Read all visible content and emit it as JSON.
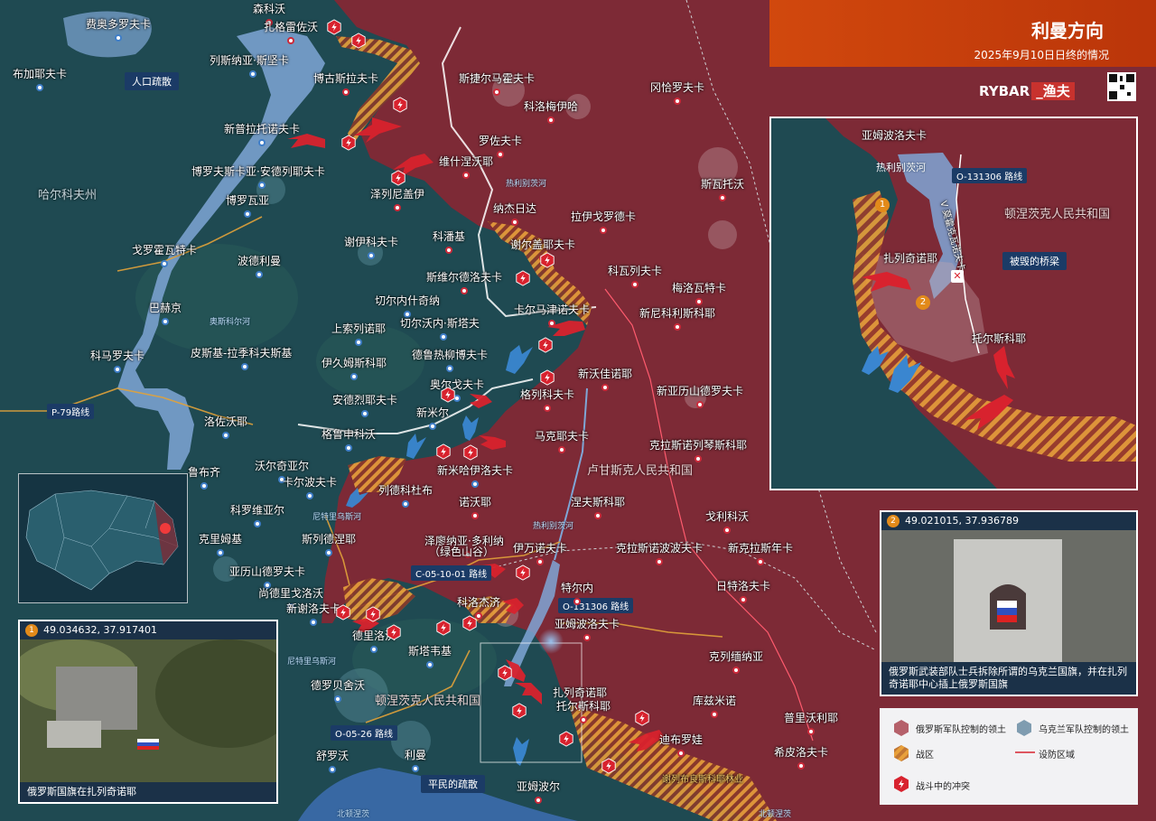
{
  "header": {
    "title": "利曼方向",
    "subtitle": "2025年9月10日日终的情况",
    "brand": "RYBAR",
    "brand_tag": "_渔夫"
  },
  "colors": {
    "russian_territory": "#7d2a36",
    "ukrainian_territory": "#1f4a52",
    "combat_zone": "#e8a03a",
    "river": "#7fa6d6",
    "accent": "#d64a0c",
    "attack_arrow_red": "#d8222e",
    "attack_arrow_blue": "#3a86d0"
  },
  "map_labels": {
    "settlements": [
      "费奥多罗夫卡",
      "森科沃",
      "扎格雷佐沃",
      "列斯纳亚·斯坚卡",
      "博古斯拉夫卡",
      "布加耶夫卡",
      "新普拉托诺夫卡",
      "博罗夫斯卡亚·安德列耶夫卡",
      "泽列尼盖伊",
      "维什涅沃耶",
      "斯捷尔马霍夫卡",
      "科洛梅伊哈",
      "罗佐夫卡",
      "冈恰罗夫卡",
      "斯瓦托沃",
      "博罗瓦亚",
      "纳杰日达",
      "拉伊戈罗德卡",
      "科潘基",
      "谢尔盖耶夫卡",
      "谢伊科夫卡",
      "戈罗霍瓦特卡",
      "波德利曼",
      "斯维尔德洛夫卡",
      "科瓦列夫卡",
      "梅洛瓦特卡",
      "巴赫京",
      "切尔内什奇纳",
      "卡尔马津诺夫卡",
      "新尼科利斯科耶",
      "上索列诺耶",
      "切尔沃内·斯塔夫",
      "科马罗夫卡",
      "皮斯基-拉季科夫斯基",
      "德鲁热柳博夫卡",
      "伊久姆斯科耶",
      "新沃佳诺耶",
      "奥尔戈夫卡",
      "格列科夫卡",
      "新亚历山德罗夫卡",
      "安德烈耶夫卡",
      "新米尔",
      "洛佐沃耶",
      "格鲁申科沃",
      "马克耶夫卡",
      "克拉斯诺列琴斯科耶",
      "鲁布齐",
      "沃尔奇亚尔",
      "卡尔波夫卡",
      "新米哈伊洛夫卡",
      "列德科杜布",
      "诺沃耶",
      "科罗维亚尔",
      "涅夫斯科耶",
      "戈利科沃",
      "克里姆基",
      "斯列德涅耶",
      "泽廖纳亚·多利纳",
      "（绿色山谷）",
      "伊万诺夫卡",
      "克拉斯诺波波夫卡",
      "新克拉斯年卡",
      "亚历山德罗夫卡",
      "尚德里戈洛沃",
      "新谢洛夫卡",
      "科洛杰济",
      "特尔内",
      "日特洛夫卡",
      "德里洛沃",
      "亚姆波洛夫卡",
      "斯塔韦基",
      "克列缅纳亚",
      "德罗贝舍沃",
      "扎列奇诺耶",
      "托尔斯科耶",
      "库兹米诺",
      "普里沃利耶",
      "迪布罗娃",
      "舒罗沃",
      "希皮洛夫卡",
      "利曼",
      "亚姆波尔"
    ],
    "regions": [
      "哈尔科夫州",
      "卢甘斯克人民共和国",
      "顿涅茨克人民共和国"
    ],
    "rivers": [
      "奥斯科尔河",
      "热利别茨河",
      "尼特里乌斯河",
      "北顿涅茨"
    ],
    "routes": [
      "P-79路线",
      "C-05-10-01 路线",
      "O-131306 路线",
      "O-05-26 路线"
    ],
    "misc": [
      "人口疏散",
      "平民的疏散",
      "谢列布良斯科耶林业"
    ]
  },
  "inset": {
    "labels": [
      "亚姆波洛夫卡",
      "热利别茨河",
      "O-131306 路线",
      "顿涅茨克人民共和国",
      "扎列奇诺耶",
      "被毁的桥梁",
      "托尔斯科耶",
      "V 莫霍克瓦诺夫卡"
    ],
    "markers": [
      "1",
      "2"
    ]
  },
  "panels": [
    {
      "num": "1",
      "coords": "49.034632, 37.917401",
      "caption": "俄罗斯国旗在扎列奇诺耶"
    },
    {
      "num": "2",
      "coords": "49.021015, 37.936789",
      "caption": "俄罗斯武装部队士兵拆除所谓的乌克兰国旗，并在扎列奇诺耶中心插上俄罗斯国旗"
    }
  ],
  "legend": {
    "items": [
      "俄罗斯军队控制的领土",
      "乌克兰军队控制的领土",
      "战区",
      "设防区域",
      "战斗中的冲突"
    ]
  }
}
